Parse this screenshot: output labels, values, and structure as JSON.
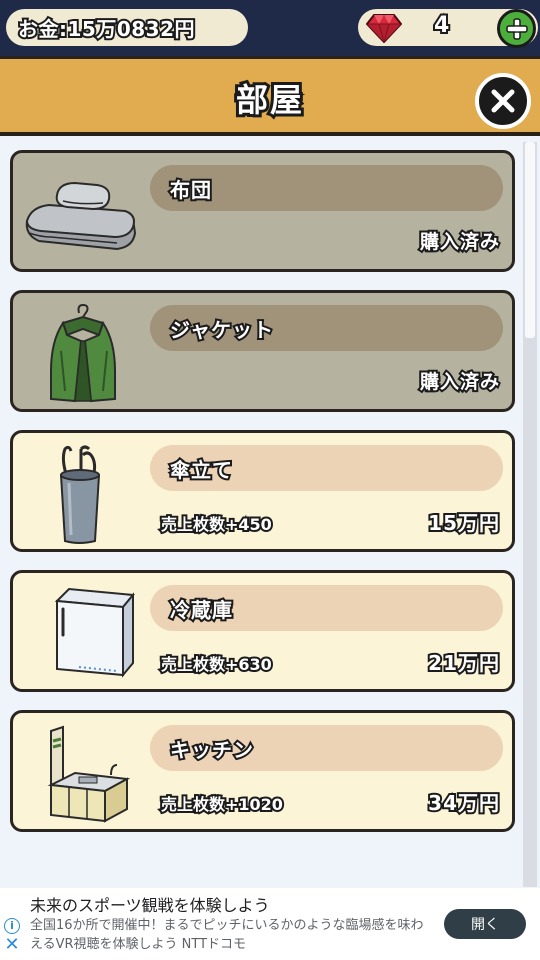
{
  "status": {
    "money_text": "お金:15万0832円",
    "gem_count": "4",
    "gem_color": "#d8283a"
  },
  "header": {
    "title": "部屋"
  },
  "list": {
    "items": [
      {
        "name": "布団",
        "state": "owned",
        "status_label": "購入済み",
        "icon": "futon-icon"
      },
      {
        "name": "ジャケット",
        "state": "owned",
        "status_label": "購入済み",
        "icon": "jacket-icon"
      },
      {
        "name": "傘立て",
        "state": "for_sale",
        "bonus": "売上枚数+450",
        "price": "15万円",
        "icon": "umbrella-stand-icon"
      },
      {
        "name": "冷蔵庫",
        "state": "for_sale",
        "bonus": "売上枚数+630",
        "price": "21万円",
        "icon": "fridge-icon"
      },
      {
        "name": "キッチン",
        "state": "for_sale",
        "bonus": "売上枚数+1020",
        "price": "34万円",
        "icon": "kitchen-icon"
      }
    ]
  },
  "ad": {
    "title": "未来のスポーツ観戦を体験しよう",
    "body": "全国16か所で開催中！まるでピッチにいるかのような臨場感を味わえるVR視聴を体験しよう NTTドコモ",
    "open_label": "開く"
  },
  "colors": {
    "topbar": "#1e2a48",
    "header": "#e0ac4f",
    "owned_card": "#b5b29f",
    "forsale_card": "#fcf4d7",
    "add_button": "#4caf3c"
  }
}
